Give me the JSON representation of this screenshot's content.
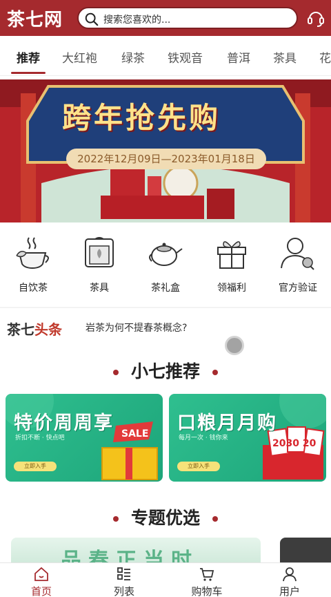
{
  "header": {
    "logo": "茶七网",
    "search_placeholder": "搜索您喜欢的...",
    "brand_color": "#a52a2e"
  },
  "tabs": [
    {
      "label": "推荐",
      "active": true
    },
    {
      "label": "大红袍"
    },
    {
      "label": "绿茶"
    },
    {
      "label": "铁观音"
    },
    {
      "label": "普洱"
    },
    {
      "label": "茶具"
    },
    {
      "label": "花"
    }
  ],
  "banner": {
    "title": "跨年抢先购",
    "date_range": "2022年12月09日—2023年01月18日"
  },
  "categories": [
    {
      "label": "自饮茶",
      "icon": "teacup-icon"
    },
    {
      "label": "茶具",
      "icon": "tea-box-icon"
    },
    {
      "label": "茶礼盒",
      "icon": "teapot-icon"
    },
    {
      "label": "领福利",
      "icon": "gift-icon"
    },
    {
      "label": "官方验证",
      "icon": "verified-user-icon"
    }
  ],
  "headline": {
    "logo_part1": "茶七",
    "logo_part2": "头条",
    "text": "岩茶为何不提春茶概念?"
  },
  "recommend": {
    "title": "小七推荐",
    "cards": [
      {
        "title": "特价周周享",
        "sub": "折扣不断 · 快点吧",
        "button": "立即入手",
        "tag": "SALE"
      },
      {
        "title": "口粮月月购",
        "sub": "每月一次 · 钱你来",
        "button": "立即入手",
        "tag": "2030 20"
      }
    ]
  },
  "topics": {
    "title": "专题优选",
    "card_text": "品春正当时"
  },
  "bottom_nav": [
    {
      "label": "首页",
      "icon": "home-icon",
      "active": true
    },
    {
      "label": "列表",
      "icon": "list-icon"
    },
    {
      "label": "购物车",
      "icon": "cart-icon"
    },
    {
      "label": "用户",
      "icon": "user-icon"
    }
  ]
}
